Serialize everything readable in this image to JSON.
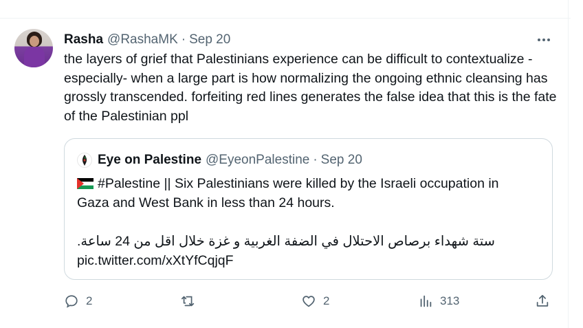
{
  "tweet": {
    "author_name": "Rasha",
    "author_handle": "@RashaMK",
    "dot": "·",
    "date": "Sep 20",
    "text": "the layers of grief that Palestinians experience can be difficult to contextualize -especially- when a large part is how normalizing the ongoing ethnic cleansing has grossly transcended. forfeiting red lines generates the false idea that this is the fate of the Palestinian ppl",
    "more_icon": "more-horizontal-icon"
  },
  "quote": {
    "author_name": "Eye on Palestine",
    "author_handle": "@EyeonPalestine",
    "dot": "·",
    "date": "Sep 20",
    "line1": "#Palestine || Six Palestinians were killed by the Israeli occupation in",
    "line2": "Gaza and West Bank in less than 24 hours.",
    "arabic": "ستة شهداء برصاص الاحتلال في الضفة الغربية و غزة خلال اقل من 24 ساعة.",
    "link": "pic.twitter.com/xXtYfCqjqF",
    "flag_icon": "palestine-flag-icon"
  },
  "actions": {
    "replies": "2",
    "retweets": "",
    "likes": "2",
    "views": "313"
  },
  "colors": {
    "text": "#0f1419",
    "secondary": "#536471",
    "border": "#cfd9de"
  }
}
